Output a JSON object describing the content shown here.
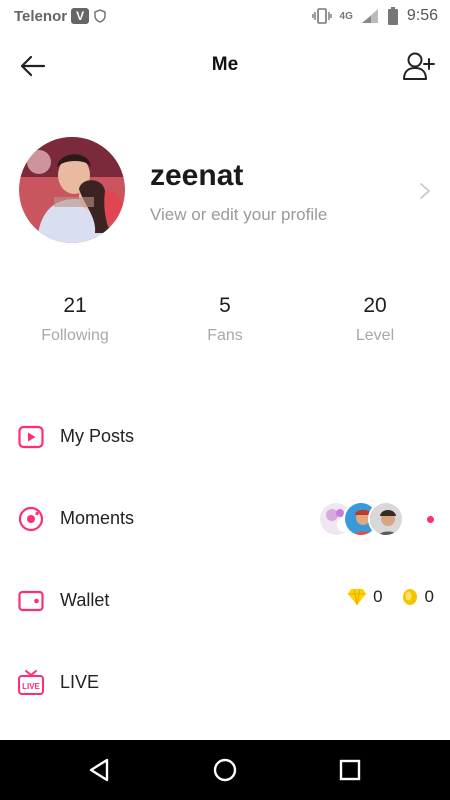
{
  "status_bar": {
    "carrier": "Telenor",
    "carrier_badge": "V",
    "network": "4G",
    "time": "9:56"
  },
  "header": {
    "title": "Me",
    "back_icon": "arrow-left-icon",
    "add_user_icon": "add-user-icon"
  },
  "profile": {
    "name": "zeenat",
    "subtitle": "View or edit your profile"
  },
  "stats": [
    {
      "value": "21",
      "label": "Following"
    },
    {
      "value": "5",
      "label": "Fans"
    },
    {
      "value": "20",
      "label": "Level"
    }
  ],
  "menu": {
    "items": [
      {
        "label": "My Posts",
        "icon": "play-square-icon"
      },
      {
        "label": "Moments",
        "icon": "moments-icon"
      },
      {
        "label": "Wallet",
        "icon": "wallet-icon"
      },
      {
        "label": "LIVE",
        "icon": "live-tv-icon"
      }
    ],
    "wallet_diamonds": "0",
    "wallet_coins": "0"
  },
  "colors": {
    "accent": "#ff2d78",
    "diamond": "#ffd400",
    "coin": "#f5c400"
  }
}
